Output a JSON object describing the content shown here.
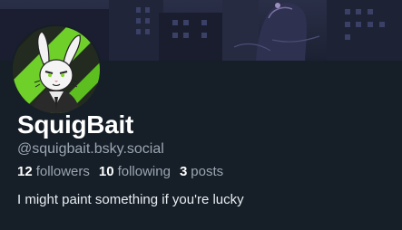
{
  "profile": {
    "display_name": "SquigBait",
    "handle": "@squigbait.bsky.social",
    "bio": "I might paint something if you're lucky",
    "stats": {
      "followers_count": "12",
      "followers_label": "followers",
      "following_count": "10",
      "following_label": "following",
      "posts_count": "3",
      "posts_label": "posts"
    }
  },
  "colors": {
    "background": "#161e27",
    "text_primary": "#ffffff",
    "text_secondary": "#9aa6b3",
    "avatar_accent": "#7cd62a"
  }
}
